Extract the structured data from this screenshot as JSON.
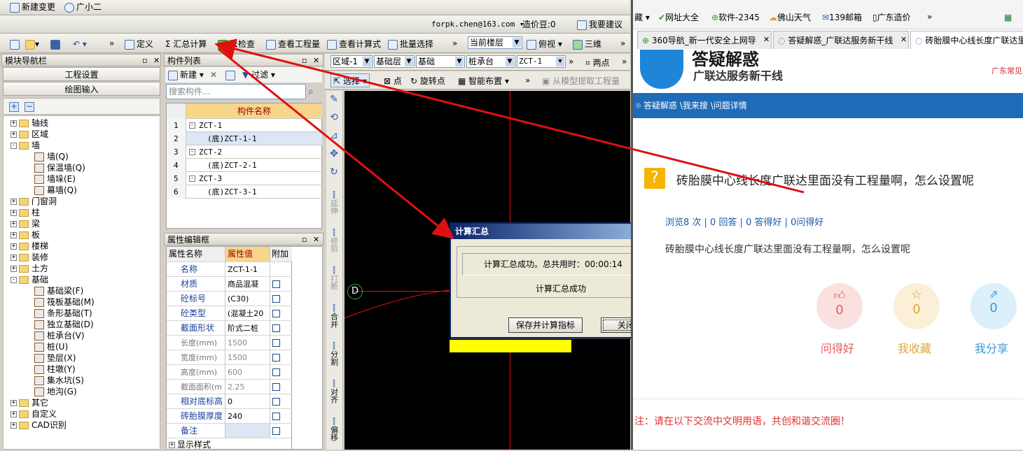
{
  "app": {
    "top_links": [
      "新建变更",
      "广小二"
    ],
    "account": "forpk.chen@163.com",
    "beans": "造价豆:0",
    "suggest": "我要建议",
    "toolbar": {
      "define": "定义",
      "sum_calc": "Σ 汇总计算",
      "cloud_check": "云检查",
      "view_qty": "查看工程量",
      "view_formula": "查看计算式",
      "batch_select": "批量选择",
      "floor": "当前楼层",
      "view_mode": "俯视",
      "three_d": "三维"
    },
    "nav": {
      "title": "模块导航栏",
      "project_settings": "工程设置",
      "drawing_input": "绘图输入",
      "tree": [
        {
          "label": "轴线",
          "level": 0,
          "exp": "+"
        },
        {
          "label": "区域",
          "level": 0,
          "exp": "+"
        },
        {
          "label": "墙",
          "level": 0,
          "exp": "-"
        },
        {
          "label": "墙(Q)",
          "level": 1
        },
        {
          "label": "保温墙(Q)",
          "level": 1
        },
        {
          "label": "墙垛(E)",
          "level": 1
        },
        {
          "label": "幕墙(Q)",
          "level": 1
        },
        {
          "label": "门窗洞",
          "level": 0,
          "exp": "+"
        },
        {
          "label": "柱",
          "level": 0,
          "exp": "+"
        },
        {
          "label": "梁",
          "level": 0,
          "exp": "+"
        },
        {
          "label": "板",
          "level": 0,
          "exp": "+"
        },
        {
          "label": "楼梯",
          "level": 0,
          "exp": "+"
        },
        {
          "label": "装修",
          "level": 0,
          "exp": "+"
        },
        {
          "label": "土方",
          "level": 0,
          "exp": "+"
        },
        {
          "label": "基础",
          "level": 0,
          "exp": "-"
        },
        {
          "label": "基础梁(F)",
          "level": 1
        },
        {
          "label": "筏板基础(M)",
          "level": 1
        },
        {
          "label": "条形基础(T)",
          "level": 1
        },
        {
          "label": "独立基础(D)",
          "level": 1
        },
        {
          "label": "桩承台(V)",
          "level": 1
        },
        {
          "label": "桩(U)",
          "level": 1
        },
        {
          "label": "垫层(X)",
          "level": 1
        },
        {
          "label": "柱墩(Y)",
          "level": 1
        },
        {
          "label": "集水坑(S)",
          "level": 1
        },
        {
          "label": "地沟(G)",
          "level": 1
        },
        {
          "label": "其它",
          "level": 0,
          "exp": "+"
        },
        {
          "label": "自定义",
          "level": 0,
          "exp": "+"
        },
        {
          "label": "CAD识别",
          "level": 0,
          "exp": "+"
        }
      ]
    },
    "components": {
      "title": "构件列表",
      "new": "新建",
      "filter": "过滤",
      "search_placeholder": "搜索构件...",
      "header": "构件名称",
      "rows": [
        {
          "no": "1",
          "name": "ZCT-1",
          "exp": "-"
        },
        {
          "no": "2",
          "name": "(底)ZCT-1-1"
        },
        {
          "no": "3",
          "name": "ZCT-2",
          "exp": "-"
        },
        {
          "no": "4",
          "name": "(底)ZCT-2-1"
        },
        {
          "no": "5",
          "name": "ZCT-3",
          "exp": "-"
        },
        {
          "no": "6",
          "name": "(底)ZCT-3-1"
        }
      ]
    },
    "props": {
      "title": "属性编辑框",
      "h_name": "属性名称",
      "h_value": "属性值",
      "h_add": "附加",
      "rows": [
        {
          "name": "名称",
          "value": "ZCT-1-1",
          "blue": true,
          "cb": false
        },
        {
          "name": "材质",
          "value": "商品混凝",
          "blue": true,
          "cb": true
        },
        {
          "name": "砼标号",
          "value": "(C30)",
          "blue": true,
          "cb": true
        },
        {
          "name": "砼类型",
          "value": "(混凝土20",
          "blue": true,
          "cb": true
        },
        {
          "name": "截面形状",
          "value": "阶式二桩",
          "blue": true,
          "cb": true
        },
        {
          "name": "长度(mm)",
          "value": "1500",
          "blue": false,
          "cb": true
        },
        {
          "name": "宽度(mm)",
          "value": "1500",
          "blue": false,
          "cb": true
        },
        {
          "name": "高度(mm)",
          "value": "600",
          "blue": false,
          "cb": true
        },
        {
          "name": "截面面积(m",
          "value": "2.25",
          "blue": false,
          "cb": true
        },
        {
          "name": "相对底标高",
          "value": "0",
          "blue": true,
          "cb": true
        },
        {
          "name": "砖胎膜厚度",
          "value": "240",
          "blue": true,
          "cb": true
        },
        {
          "name": "备注",
          "value": "",
          "blue": true,
          "cb": true
        }
      ],
      "display_style": "显示样式"
    },
    "filter_bar": {
      "area": "区域-1",
      "layer": "基础层",
      "type": "基础",
      "sub": "桩承台",
      "comp": "ZCT-1",
      "two_points": "两点"
    },
    "draw_bar": {
      "select": "选择",
      "point": "点",
      "rotate_point": "旋转点",
      "smart_layout": "智能布置",
      "extract": "从模型提取工程量"
    },
    "vtools": [
      "延伸",
      "修剪",
      "打断",
      "合并",
      "分割",
      "对齐",
      "偏移"
    ],
    "canvas_marker": "D",
    "dialog": {
      "title": "计算汇总",
      "message": "计算汇总成功。总共用时：00:00:14",
      "status": "计算汇总成功",
      "save_btn": "保存并计算指标",
      "close_btn": "关闭"
    }
  },
  "browser": {
    "bookmarks": [
      "藏",
      "网址大全",
      "软件-2345",
      "佛山天气",
      "139邮箱",
      "广东造价"
    ],
    "tabs": [
      "360导航_新一代安全上网导",
      "答疑解惑_广联达服务新干线",
      "砖胎膜中心线长度广联达里"
    ],
    "brand": "答疑解惑",
    "brand_sub": "广联达服务新干线",
    "region": "广东常见",
    "breadcrumb": "答疑解惑 \\我来搜 \\问题详情",
    "question_title": "砖胎膜中心线长度广联达里面没有工程量啊，怎么设置呢",
    "stats": "浏览8 次 | 0 回答 | 0 答得好 | 0问得好",
    "question_body": "砖胎膜中心线长度广联达里面没有工程量啊，怎么设置呢",
    "actions": [
      {
        "count": "0",
        "label": "问得好"
      },
      {
        "count": "0",
        "label": "我收藏"
      },
      {
        "count": "0",
        "label": "我分享"
      }
    ],
    "notice": "注：请在以下交流中文明用语，共创和谐交流圈！"
  },
  "colors": {
    "accent_blue": "#1e6bb8",
    "arrow_red": "#e01010",
    "dialog_title": "#0a246a",
    "highlight_yellow": "#ffff00",
    "link_blue": "#1a5aa6"
  }
}
